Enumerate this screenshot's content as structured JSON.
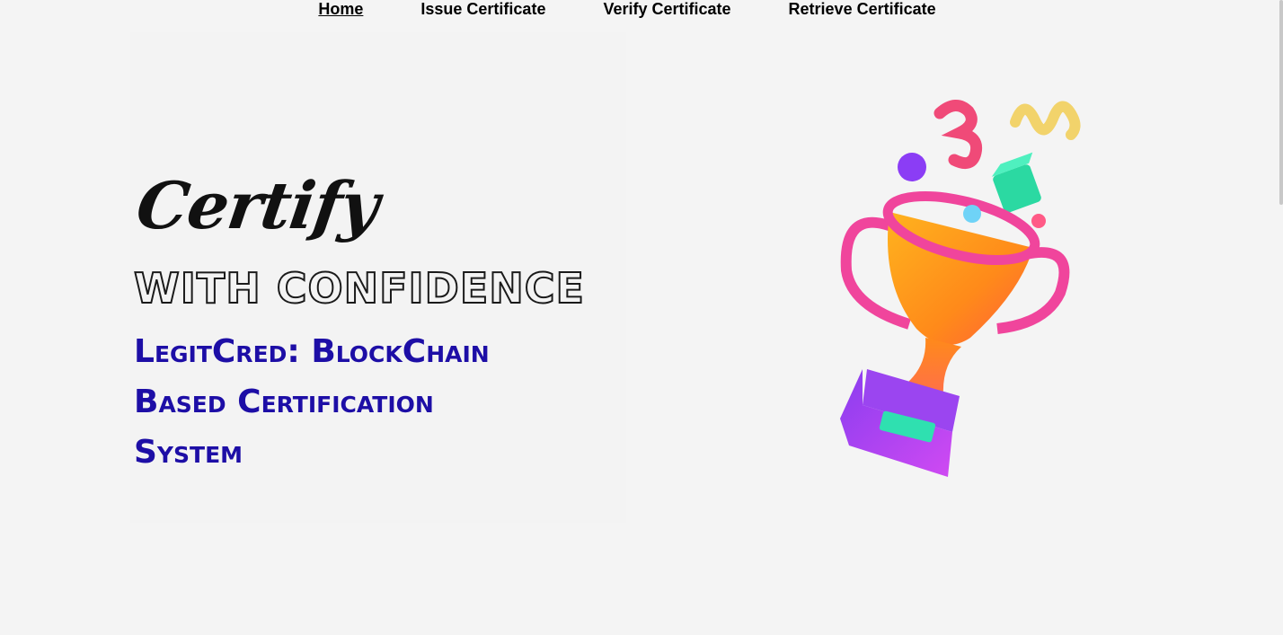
{
  "nav": {
    "items": [
      {
        "label": "Home",
        "active": true
      },
      {
        "label": "Issue Certificate",
        "active": false
      },
      {
        "label": "Verify Certificate",
        "active": false
      },
      {
        "label": "Retrieve Certificate",
        "active": false
      }
    ]
  },
  "hero": {
    "script_word": "Certify",
    "tagline": "WITH CONFIDENCE",
    "system_name": "LegitCred: BlockChain Based Certification System"
  },
  "icons": {
    "trophy": "trophy-illustration"
  },
  "colors": {
    "background": "#f4f4f4",
    "system_name": "#1d0ea6",
    "trophy_cup": "#ff9b1a",
    "trophy_handles": "#f0459c",
    "trophy_base": "#b245f2",
    "plaque": "#2fe0b0"
  }
}
